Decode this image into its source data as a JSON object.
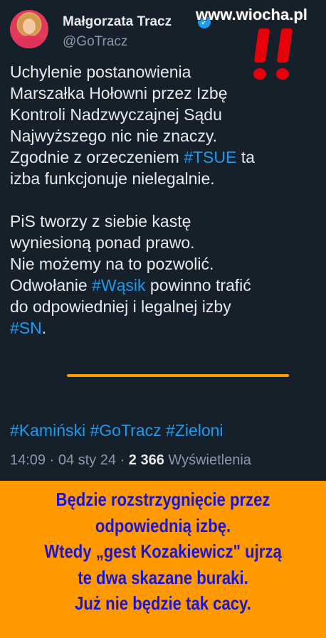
{
  "tweet": {
    "author_name": "Małgorzata Tracz",
    "handle": "@GoTracz",
    "verified_glyph": "✓",
    "body_lines_1": [
      "Uchylenie postanowienia",
      "Marszałka Hołowni przez Izbę",
      "Kontroli Nadzwyczajnej Sądu",
      "Najwyższego nic nie znaczy."
    ],
    "line5_pre": "Zgodnie z orzeczeniem ",
    "line5_tag": "#TSUE",
    "line5_post": " ta",
    "line6": "izba funkcjonuje nielegalnie.",
    "body_lines_2": [
      "PiS tworzy z siebie kastę",
      "wyniesioną ponad prawo.",
      "Nie możemy na to pozwolić."
    ],
    "line10_pre": "Odwołanie ",
    "line10_tag": "#Wąsik",
    "line10_post": " powinno trafić",
    "line11": "do odpowiedniej i legalnej izby",
    "line12_tag": "#SN",
    "line12_post": ".",
    "hashtags": "#Kamiński #GoTracz #Zieloni",
    "time": "14:09 · 04 sty 24 · ",
    "views_count": "2 366",
    "views_label": " Wyświetlenia"
  },
  "watermark": "www.wiocha.pl",
  "banner": {
    "lines": [
      "Będzie rozstrzygnięcie przez",
      "odpowiednią izbę.",
      "Wtedy „gest Kozakiewicz\" ujrzą",
      "te dwa skazane buraki.",
      "Już nie będzie tak cacy."
    ]
  },
  "colors": {
    "background": "#15202b",
    "text": "#e7e9ea",
    "hashtag": "#1d9bf0",
    "banner_bg": "#ff9900",
    "banner_text": "#1a14d8",
    "exclamation": "#e8000b"
  }
}
